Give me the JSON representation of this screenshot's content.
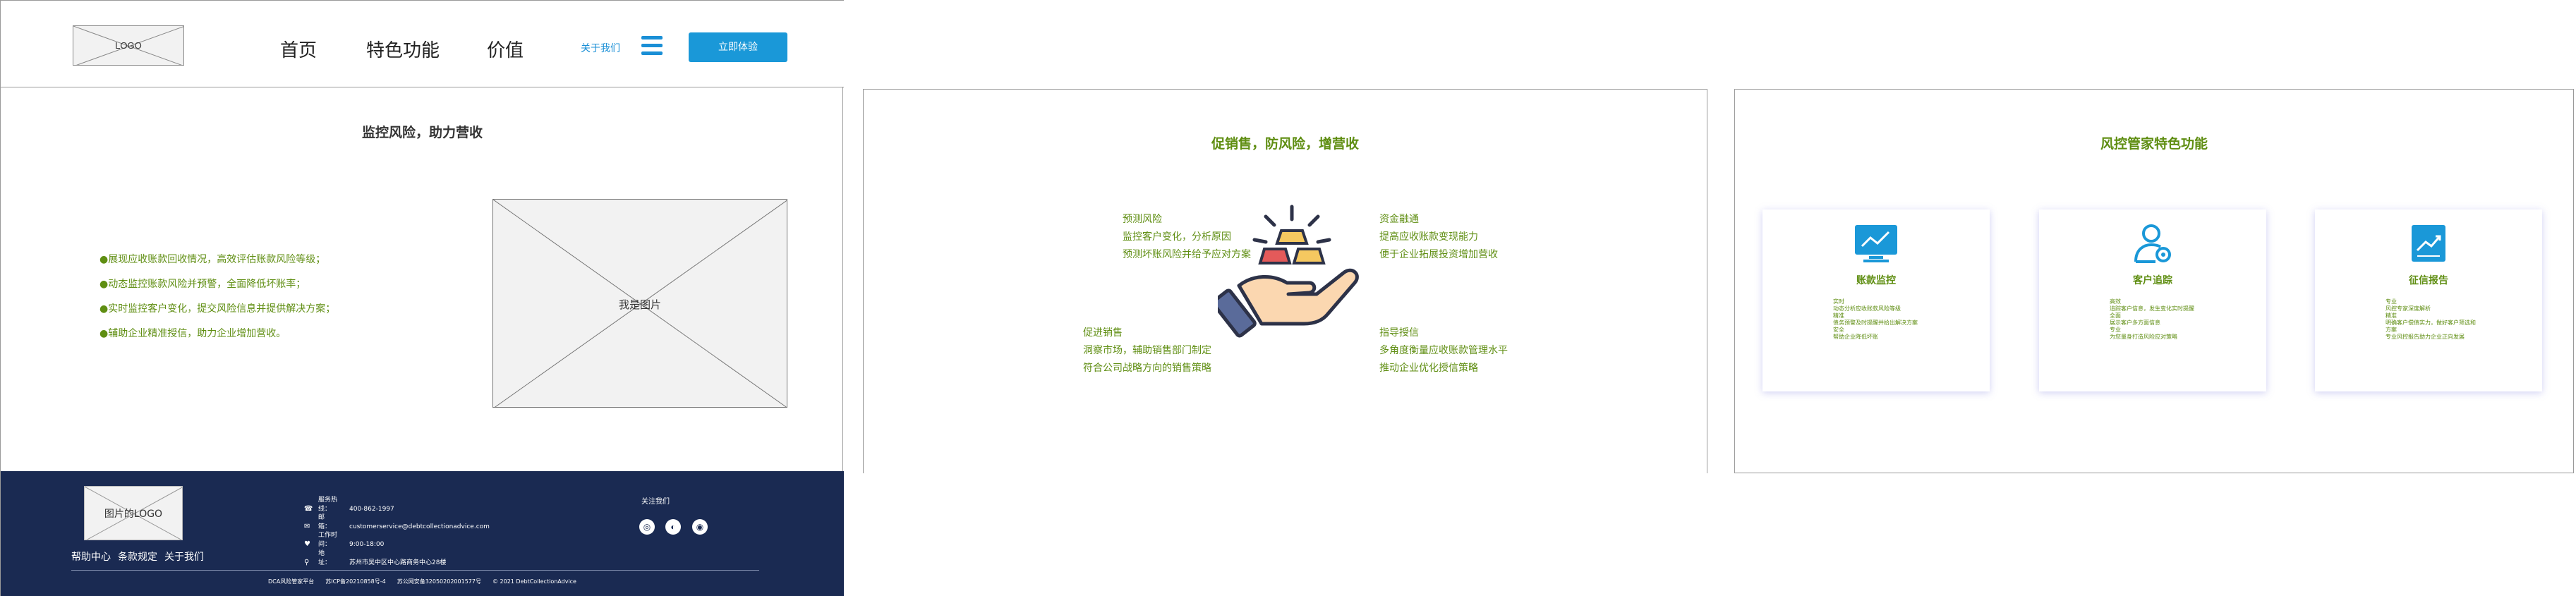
{
  "header": {
    "logo_text": "LOGO",
    "nav": [
      "首页",
      "特色功能",
      "价值"
    ],
    "about_link": "关于我们",
    "cta_label": "立即体验"
  },
  "intro": {
    "title": "监控风险，助力营收",
    "bullets": [
      "●展现应收账款回收情况，高效评估账款风险等级；",
      "●动态监控账款风险并预警，全面降低坏账率；",
      "●实时监控客户变化，提交风险信息并提供解决方案；",
      "●辅助企业精准授信，助力企业增加营收。"
    ],
    "image_placeholder": "我是图片"
  },
  "footer": {
    "logo_text": "图片的LOGO",
    "links": [
      "帮助中心",
      "条款规定",
      "关于我们"
    ],
    "contacts": [
      {
        "icon": "phone-icon",
        "glyph": "☎",
        "label": "服务热线：",
        "value": "400-862-1997"
      },
      {
        "icon": "mail-icon",
        "glyph": "✉",
        "label": "邮　　箱：",
        "value": "customerservice@debtcollectionadvice.com"
      },
      {
        "icon": "heart-icon",
        "glyph": "♥",
        "label": "工作时间：",
        "value": "9:00-18:00"
      },
      {
        "icon": "location-icon",
        "glyph": "⚲",
        "label": "地　　址：",
        "value": "苏州市吴中区中心路商务中心28楼"
      }
    ],
    "follow_label": "关注我们",
    "social": [
      {
        "icon": "weibo-icon",
        "glyph": "◎"
      },
      {
        "icon": "wechat-icon",
        "glyph": "◐"
      },
      {
        "icon": "qq-icon",
        "glyph": "◉"
      }
    ],
    "copyright": [
      "DCA风险管家平台",
      "苏ICP备20210858号-4",
      "苏公网安备32050202001577号",
      "© 2021 DebtCollectionAdvice"
    ]
  },
  "value": {
    "title": "促销售，防风险，增营收",
    "top_left": [
      "预测风险",
      "监控客户变化，分析原因",
      "预测坏账风险并给予应对方案"
    ],
    "top_right": [
      "资金融通",
      "提高应收账款变现能力",
      "便于企业拓展投资增加营收"
    ],
    "bottom_left": [
      "促进销售",
      "洞察市场，辅助销售部门制定",
      "符合公司战略方向的销售策略"
    ],
    "bottom_right": [
      "指导授信",
      "多角度衡量应收账款管理水平",
      "推动企业优化授信策略"
    ]
  },
  "features": {
    "title": "风控管家特色功能",
    "cards": [
      {
        "icon": "monitor-chart-icon",
        "title": "账款监控",
        "lines": [
          "实时",
          "动态分析应收账款风险等级",
          "精准",
          "债务预警及时提醒并给出解决方案",
          "安全",
          "帮助企业降低坏账"
        ]
      },
      {
        "icon": "user-track-icon",
        "title": "客户追踪",
        "lines": [
          "高效",
          "追踪客户信息，发生变化实时提醒",
          "全面",
          "展示客户多方面信息",
          "专业",
          "为您量身打造风险应对策略"
        ]
      },
      {
        "icon": "report-trend-icon",
        "title": "征信报告",
        "lines": [
          "专业",
          "风控专家深度解析",
          "精准",
          "明确客户偿债实力，做好客户筛选和",
          "方案",
          "专业风控报告助力企业正向发展"
        ]
      }
    ]
  },
  "colors": {
    "accent_green": "#5f8e12",
    "brand_blue": "#1a98d8",
    "footer_navy": "#1a2a52"
  }
}
